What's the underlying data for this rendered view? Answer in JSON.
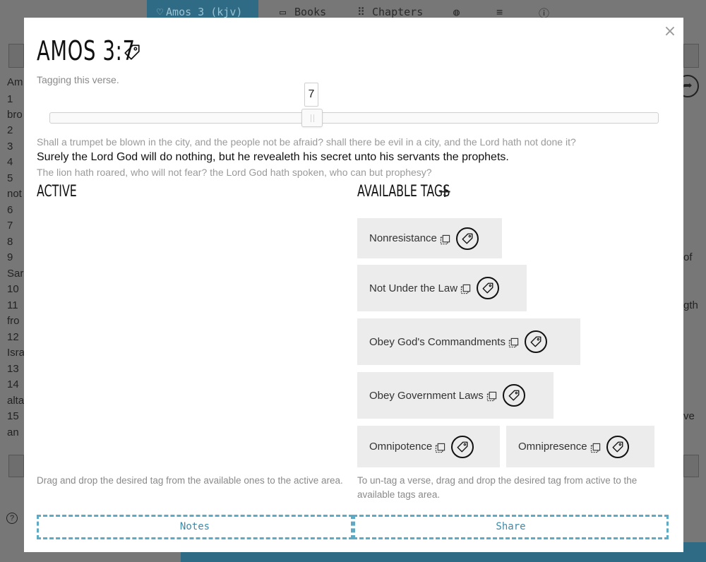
{
  "background": {
    "nav": {
      "current_chapter": "Amos 3 (kjv)",
      "books_label": "Books",
      "chapters_label": "Chapters"
    },
    "left_fragments": [
      "Am",
      "1",
      "bro",
      "2",
      "3",
      "4",
      "5",
      "not",
      "6",
      "7",
      "8",
      "9",
      "Sar",
      "10",
      "11",
      "fro",
      "12",
      "Isra",
      "13",
      "14",
      "alta",
      "15",
      "an"
    ],
    "right_fragments": [
      "of",
      "gth",
      "ve"
    ]
  },
  "modal": {
    "title": "AMOS 3:7",
    "subtitle": "Tagging this verse.",
    "slider": {
      "value": "7",
      "fraction": 0.43
    },
    "prev_verse": "Shall a trumpet be blown in the city, and the people not be afraid? shall there be evil in a city, and the Lord hath not done it?",
    "current_verse": "Surely the Lord God will do nothing, but he revealeth his secret unto his servants the prophets.",
    "next_verse": "The lion hath roared, who will not fear? the Lord God hath spoken, who can but prophesy?",
    "active_heading": "ACTIVE",
    "available_heading": "AVAILABLE TAGS",
    "add_symbol": "+",
    "available_tags": [
      "Nonresistance",
      "Not Under the Law",
      "Obey God's Commandments",
      "Obey Government Laws",
      "Omnipotence",
      "Omnipresence"
    ],
    "active_help": "Drag and drop the desired tag from the available ones to the active area.",
    "available_help": "To un-tag a verse, drag and drop the desired tag from active to the available tags area.",
    "notes_label": "Notes",
    "share_label": "Share",
    "close_symbol": "×"
  },
  "colors": {
    "accent": "#5ea9c4",
    "chip_bg": "#ececec",
    "nav_active": "#2f6b84"
  }
}
